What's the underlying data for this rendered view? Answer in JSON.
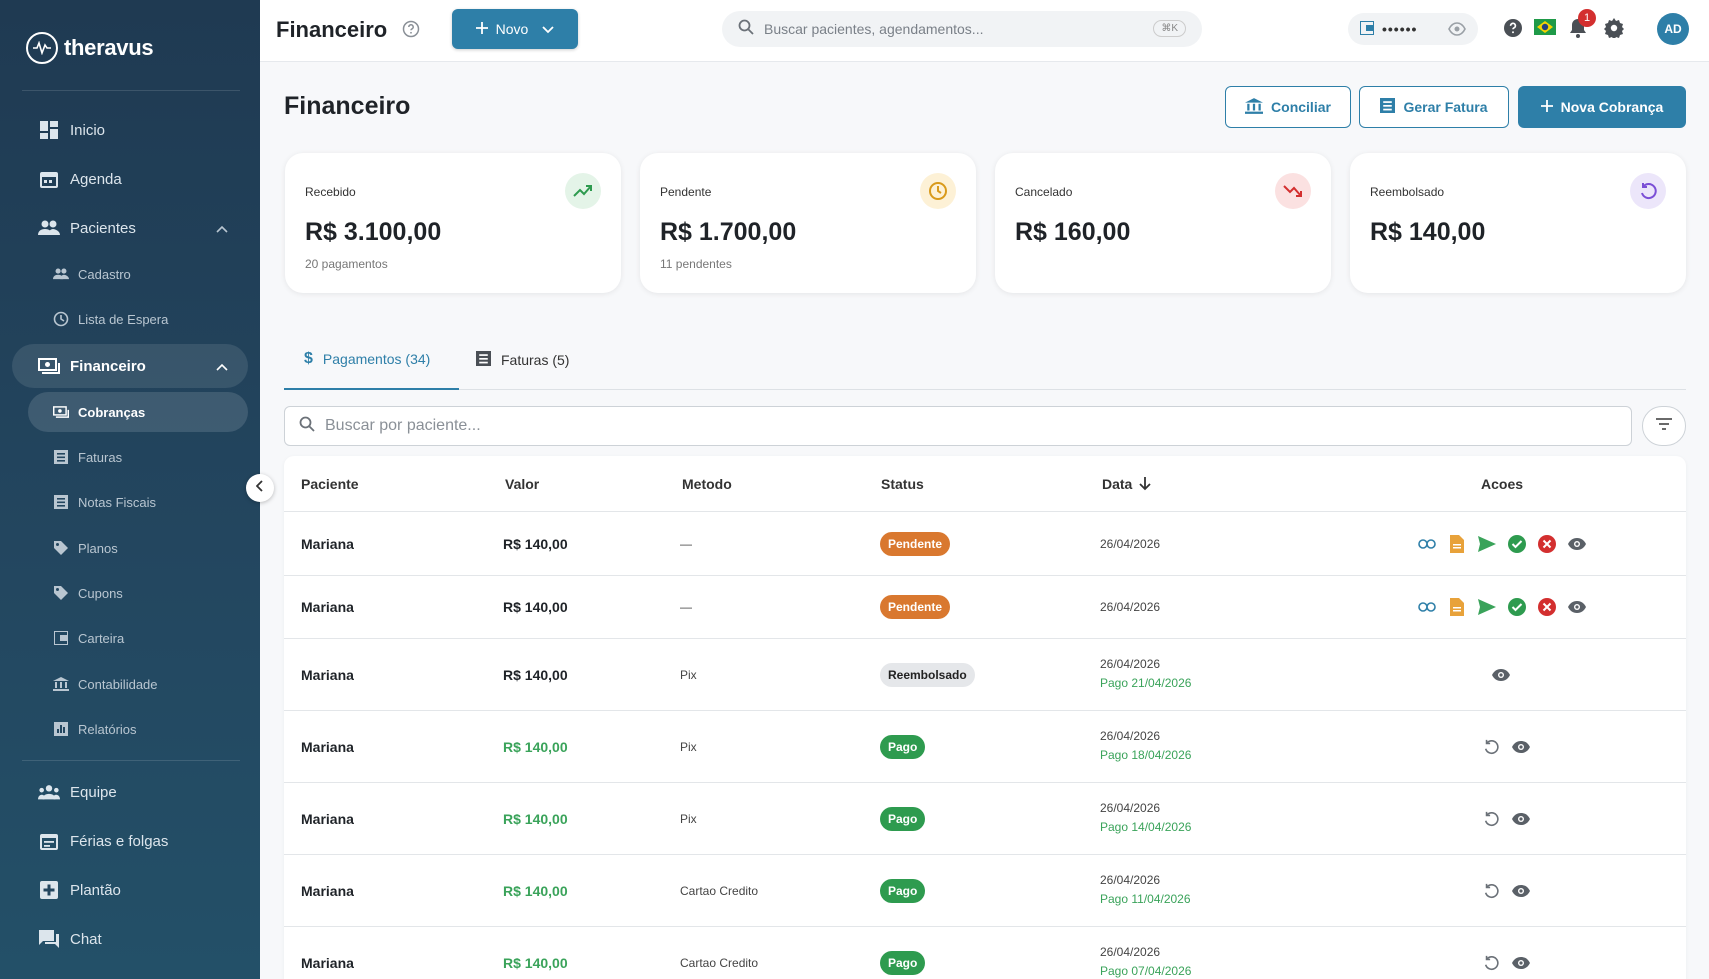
{
  "app": {
    "brand": "theravus"
  },
  "sidebar": {
    "items": [
      {
        "label": "Inicio"
      },
      {
        "label": "Agenda"
      },
      {
        "label": "Pacientes"
      },
      {
        "label": "Cadastro"
      },
      {
        "label": "Lista de Espera"
      },
      {
        "label": "Financeiro"
      },
      {
        "label": "Cobranças"
      },
      {
        "label": "Faturas"
      },
      {
        "label": "Notas Fiscais"
      },
      {
        "label": "Planos"
      },
      {
        "label": "Cupons"
      },
      {
        "label": "Carteira"
      },
      {
        "label": "Contabilidade"
      },
      {
        "label": "Relatórios"
      },
      {
        "label": "Equipe"
      },
      {
        "label": "Férias e folgas"
      },
      {
        "label": "Plantão"
      },
      {
        "label": "Chat"
      }
    ]
  },
  "topbar": {
    "title": "Financeiro",
    "new_label": "Novo",
    "search_placeholder": "Buscar pacientes, agendamentos...",
    "shortcut": "⌘K",
    "wallet_masked": "••••••",
    "notification_count": "1",
    "avatar_initials": "AD"
  },
  "page": {
    "title": "Financeiro",
    "buttons": {
      "conciliar": "Conciliar",
      "gerar_fatura": "Gerar Fatura",
      "nova_cobranca": "Nova Cobrança"
    }
  },
  "summary": [
    {
      "label": "Recebido",
      "value": "R$ 3.100,00",
      "sub": "20 pagamentos"
    },
    {
      "label": "Pendente",
      "value": "R$ 1.700,00",
      "sub": "11 pendentes"
    },
    {
      "label": "Cancelado",
      "value": "R$ 160,00",
      "sub": ""
    },
    {
      "label": "Reembolsado",
      "value": "R$ 140,00",
      "sub": ""
    }
  ],
  "tabs": [
    {
      "label": "Pagamentos (34)"
    },
    {
      "label": "Faturas (5)"
    }
  ],
  "search": {
    "placeholder": "Buscar por paciente..."
  },
  "table": {
    "columns": [
      "Paciente",
      "Valor",
      "Metodo",
      "Status",
      "Data",
      "Acoes"
    ],
    "rows": [
      {
        "patient": "Mariana",
        "value": "R$ 140,00",
        "method": "—",
        "status": "Pendente",
        "date": "26/04/2026",
        "paid": ""
      },
      {
        "patient": "Mariana",
        "value": "R$ 140,00",
        "method": "—",
        "status": "Pendente",
        "date": "26/04/2026",
        "paid": ""
      },
      {
        "patient": "Mariana",
        "value": "R$ 140,00",
        "method": "Pix",
        "status": "Reembolsado",
        "date": "26/04/2026",
        "paid": "Pago 21/04/2026"
      },
      {
        "patient": "Mariana",
        "value": "R$ 140,00",
        "method": "Pix",
        "status": "Pago",
        "date": "26/04/2026",
        "paid": "Pago 18/04/2026"
      },
      {
        "patient": "Mariana",
        "value": "R$ 140,00",
        "method": "Pix",
        "status": "Pago",
        "date": "26/04/2026",
        "paid": "Pago 14/04/2026"
      },
      {
        "patient": "Mariana",
        "value": "R$ 140,00",
        "method": "Cartao Credito",
        "status": "Pago",
        "date": "26/04/2026",
        "paid": "Pago 11/04/2026"
      },
      {
        "patient": "Mariana",
        "value": "R$ 140,00",
        "method": "Cartao Credito",
        "status": "Pago",
        "date": "26/04/2026",
        "paid": "Pago 07/04/2026"
      }
    ]
  },
  "colors": {
    "accent": "#2e7fa8",
    "pending": "#d9782f",
    "paid": "#2e9b4f",
    "sidebar": "#1f3a52"
  }
}
